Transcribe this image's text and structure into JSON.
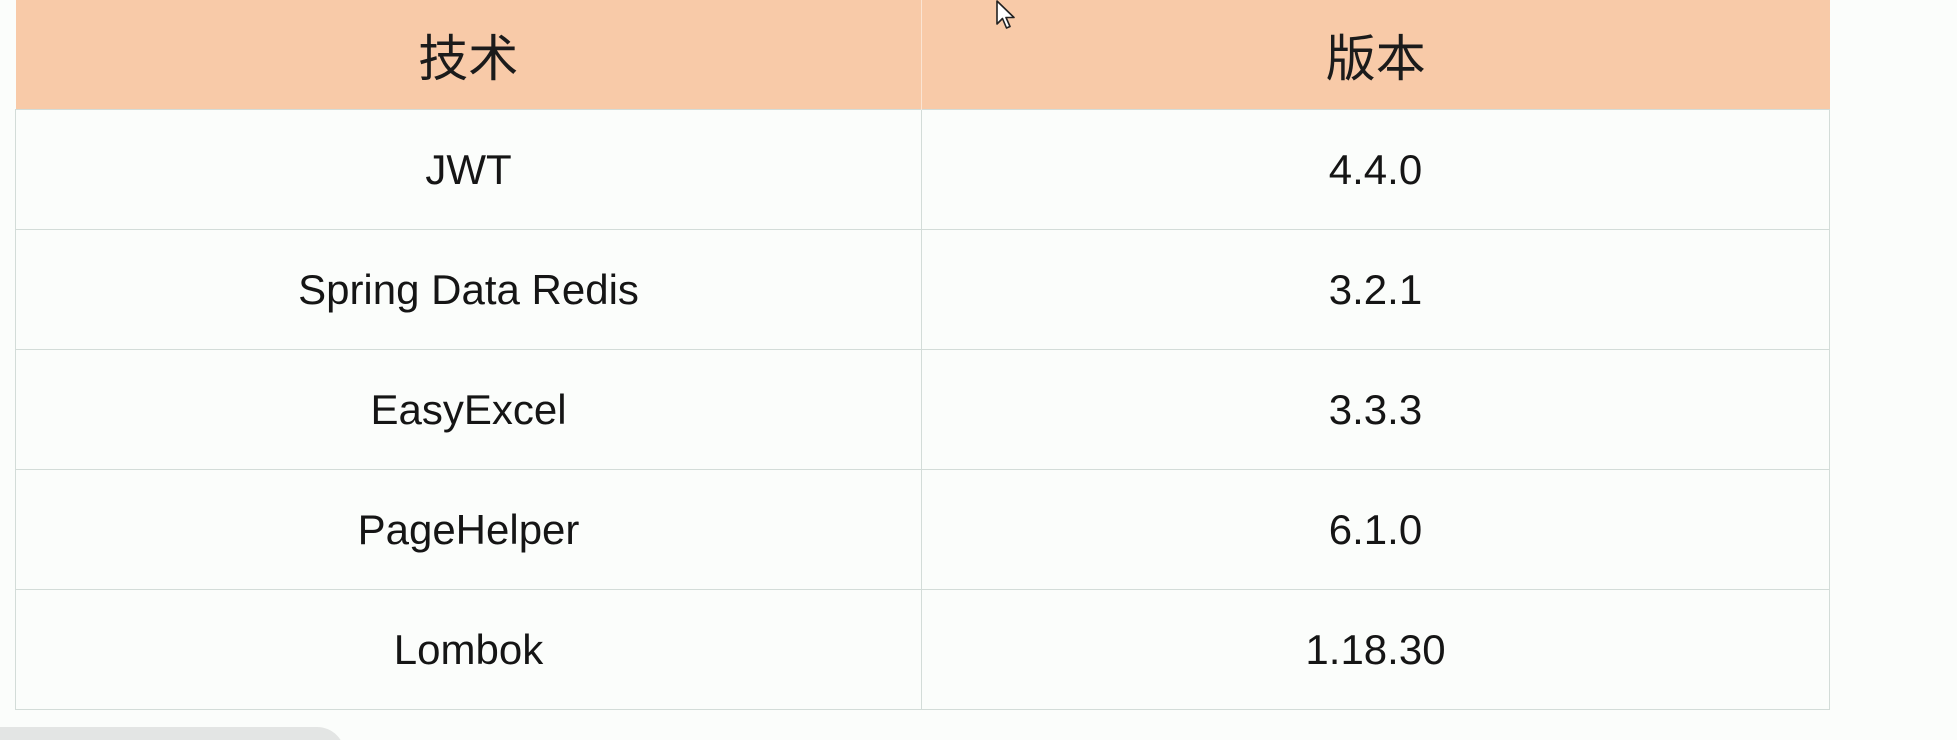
{
  "table": {
    "headers": [
      "技术",
      "版本"
    ],
    "rows": [
      {
        "technology": "JWT",
        "version": "4.4.0"
      },
      {
        "technology": "Spring Data Redis",
        "version": "3.2.1"
      },
      {
        "technology": "EasyExcel",
        "version": "3.3.3"
      },
      {
        "technology": "PageHelper",
        "version": "6.1.0"
      },
      {
        "technology": "Lombok",
        "version": "1.18.30"
      }
    ]
  },
  "colors": {
    "header_background": "#f8caa8",
    "body_background": "#fbfdfb",
    "grid_line": "#d3dcd8"
  },
  "icons": {
    "cursor": "mouse-pointer-icon"
  }
}
